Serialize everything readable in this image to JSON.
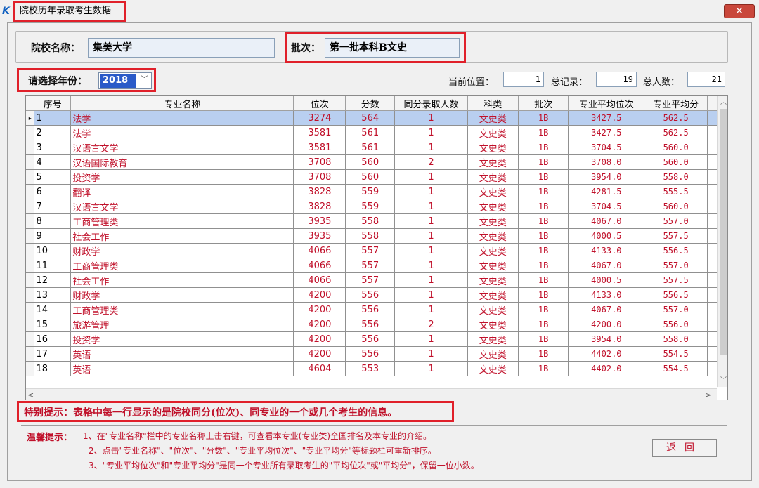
{
  "window": {
    "title": "院校历年录取考生数据",
    "close_glyph": "✕"
  },
  "header": {
    "school_label": "院校名称：",
    "school_value": "集美大学",
    "batch_label": "批次：",
    "batch_value": "第一批本科B文史"
  },
  "year": {
    "label": "请选择年份：",
    "value": "2018",
    "arrow": "﹀"
  },
  "stats": {
    "position_label": "当前位置：",
    "position_value": "1",
    "total_label": "总记录：",
    "total_value": "19",
    "people_label": "总人数：",
    "people_value": "21"
  },
  "table": {
    "columns": [
      "序号",
      "专业名称",
      "位次",
      "分数",
      "同分录取人数",
      "科类",
      "批次",
      "专业平均位次",
      "专业平均分"
    ],
    "selected_index": 0,
    "row_indicator": "▸",
    "rows": [
      [
        "1",
        "法学",
        "3274",
        "564",
        "1",
        "文史类",
        "1B",
        "3427.5",
        "562.5"
      ],
      [
        "2",
        "法学",
        "3581",
        "561",
        "1",
        "文史类",
        "1B",
        "3427.5",
        "562.5"
      ],
      [
        "3",
        "汉语言文学",
        "3581",
        "561",
        "1",
        "文史类",
        "1B",
        "3704.5",
        "560.0"
      ],
      [
        "4",
        "汉语国际教育",
        "3708",
        "560",
        "2",
        "文史类",
        "1B",
        "3708.0",
        "560.0"
      ],
      [
        "5",
        "投资学",
        "3708",
        "560",
        "1",
        "文史类",
        "1B",
        "3954.0",
        "558.0"
      ],
      [
        "6",
        "翻译",
        "3828",
        "559",
        "1",
        "文史类",
        "1B",
        "4281.5",
        "555.5"
      ],
      [
        "7",
        "汉语言文学",
        "3828",
        "559",
        "1",
        "文史类",
        "1B",
        "3704.5",
        "560.0"
      ],
      [
        "8",
        "工商管理类",
        "3935",
        "558",
        "1",
        "文史类",
        "1B",
        "4067.0",
        "557.0"
      ],
      [
        "9",
        "社会工作",
        "3935",
        "558",
        "1",
        "文史类",
        "1B",
        "4000.5",
        "557.5"
      ],
      [
        "10",
        "财政学",
        "4066",
        "557",
        "1",
        "文史类",
        "1B",
        "4133.0",
        "556.5"
      ],
      [
        "11",
        "工商管理类",
        "4066",
        "557",
        "1",
        "文史类",
        "1B",
        "4067.0",
        "557.0"
      ],
      [
        "12",
        "社会工作",
        "4066",
        "557",
        "1",
        "文史类",
        "1B",
        "4000.5",
        "557.5"
      ],
      [
        "13",
        "财政学",
        "4200",
        "556",
        "1",
        "文史类",
        "1B",
        "4133.0",
        "556.5"
      ],
      [
        "14",
        "工商管理类",
        "4200",
        "556",
        "1",
        "文史类",
        "1B",
        "4067.0",
        "557.0"
      ],
      [
        "15",
        "旅游管理",
        "4200",
        "556",
        "2",
        "文史类",
        "1B",
        "4200.0",
        "556.0"
      ],
      [
        "16",
        "投资学",
        "4200",
        "556",
        "1",
        "文史类",
        "1B",
        "3954.0",
        "558.0"
      ],
      [
        "17",
        "英语",
        "4200",
        "556",
        "1",
        "文史类",
        "1B",
        "4402.0",
        "554.5"
      ],
      [
        "18",
        "英语",
        "4604",
        "553",
        "1",
        "文史类",
        "1B",
        "4402.0",
        "554.5"
      ]
    ]
  },
  "scroll": {
    "up": "︿",
    "down": "﹀",
    "left": "<",
    "right": ">"
  },
  "notes": {
    "special": "特别提示：表格中每一行显示的是院校同分(位次)、同专业的一个或几个考生的信息。",
    "tips_label": "温馨提示：",
    "tip1": "1、在\"专业名称\"栏中的专业名称上击右键，可查看本专业(专业类)全国排名及本专业的介绍。",
    "tip2": "2、点击\"专业名称\"、\"位次\"、\"分数\"、\"专业平均位次\"、\"专业平均分\"等标题栏可重新排序。",
    "tip3": "3、\"专业平均位次\"和\"专业平均分\"是同一个专业所有录取考生的\"平均位次\"或\"平均分\"，保留一位小数。"
  },
  "buttons": {
    "return": "返回"
  },
  "colors": {
    "highlight_border": "#e0202a",
    "data_text": "#c0102a",
    "selected_row": "#b9cff0",
    "year_select": "#2a5ac8"
  }
}
